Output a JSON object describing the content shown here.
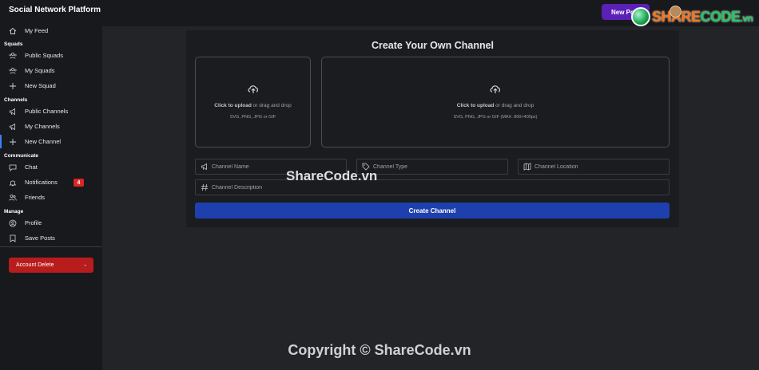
{
  "app": {
    "title": "Social Network Platform"
  },
  "header": {
    "new_post_label": "New Post"
  },
  "brand": {
    "share": "SHARE",
    "code": "CODE",
    "vn": ".vn"
  },
  "sidebar": {
    "feed": {
      "label": "My Feed",
      "icon": "home-icon"
    },
    "sections": {
      "squads": "Squads",
      "channels": "Channels",
      "communicate": "Communicate",
      "manage": "Manage"
    },
    "squads": [
      {
        "label": "Public Squads",
        "icon": "users-icon"
      },
      {
        "label": "My Squads",
        "icon": "users-icon"
      },
      {
        "label": "New Squad",
        "icon": "plus-icon"
      }
    ],
    "channels": [
      {
        "label": "Public Channels",
        "icon": "megaphone-icon"
      },
      {
        "label": "My Channels",
        "icon": "megaphone-icon"
      },
      {
        "label": "New Channel",
        "icon": "plus-icon"
      }
    ],
    "communicate": [
      {
        "label": "Chat",
        "icon": "chat-icon"
      },
      {
        "label": "Notifications",
        "icon": "bell-icon",
        "badge": "4"
      },
      {
        "label": "Friends",
        "icon": "friends-icon"
      }
    ],
    "manage": [
      {
        "label": "Profile",
        "icon": "profile-icon"
      },
      {
        "label": "Save Posts",
        "icon": "bookmark-icon"
      }
    ],
    "account_delete": {
      "label": "Account Delete",
      "dash": "-"
    }
  },
  "main": {
    "title": "Create Your Own Channel",
    "dropzone_small": {
      "strong": "Click to upload",
      "rest": " or drag and drop",
      "hint": "SVG, PNG, JPG or GIF"
    },
    "dropzone_large": {
      "strong": "Click to upload",
      "rest": " or drag and drop",
      "hint": "SVG, PNG, JPG or GIF (MAX. 800×400px)"
    },
    "fields": {
      "name": {
        "placeholder": "Channel Name"
      },
      "type": {
        "placeholder": "Channel Type"
      },
      "location": {
        "placeholder": "Channel Location"
      },
      "description": {
        "placeholder": "Channel Description"
      }
    },
    "submit_label": "Create Channel"
  },
  "watermark": {
    "center": "ShareCode.vn",
    "bottom": "Copyright © ShareCode.vn"
  },
  "colors": {
    "background": "#232427",
    "sidebar": "#18191c",
    "primary_button": "#1e40af",
    "danger": "#b91c1c",
    "new_post": "#5b21b6",
    "active_indicator": "#3b82f6"
  }
}
